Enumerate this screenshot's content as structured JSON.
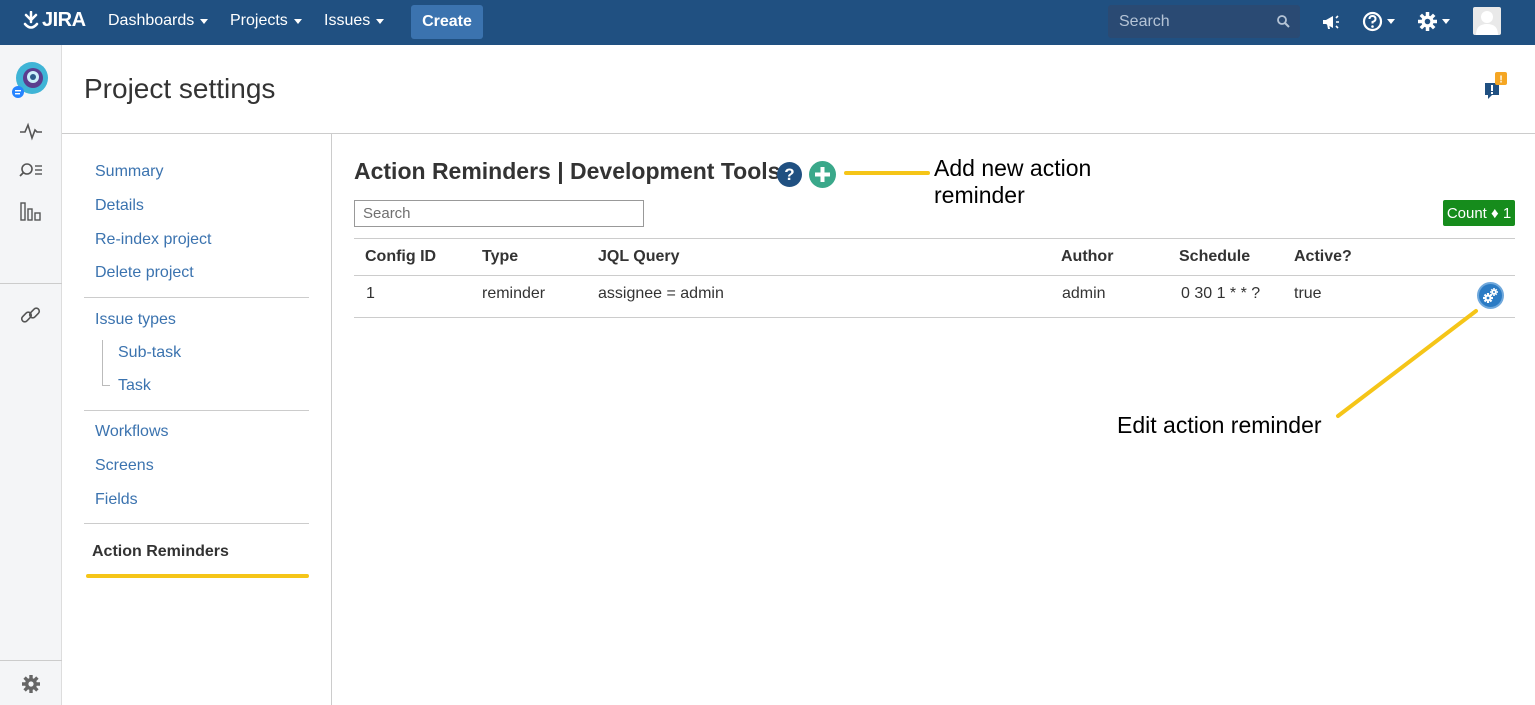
{
  "topbar": {
    "logo": "JIRA",
    "nav": [
      "Dashboards",
      "Projects",
      "Issues"
    ],
    "create_label": "Create",
    "search_placeholder": "Search"
  },
  "header": {
    "title": "Project settings",
    "feedback_badge": "!"
  },
  "settings_nav": {
    "group1": [
      "Summary",
      "Details",
      "Re-index project",
      "Delete project"
    ],
    "issue_types": "Issue types",
    "issue_type_children": [
      "Sub-task",
      "Task"
    ],
    "group3": [
      "Workflows",
      "Screens",
      "Fields"
    ],
    "active": "Action Reminders"
  },
  "main": {
    "title": "Action Reminders | Development Tools",
    "help_label": "?",
    "search_placeholder": "Search",
    "count_label": "Count ♦ 1",
    "annotation_add": "Add new action reminder",
    "annotation_edit": "Edit action reminder",
    "columns": [
      "Config ID",
      "Type",
      "JQL Query",
      "Author",
      "Schedule",
      "Active?"
    ],
    "rows": [
      {
        "config_id": "1",
        "type": "reminder",
        "jql": "assignee = admin",
        "author": "admin",
        "schedule": "0 30 1 * * ?",
        "active": "true"
      }
    ]
  },
  "colors": {
    "topbar": "#205081",
    "link": "#3b73af",
    "highlight": "#f5c518",
    "count_badge": "#168c1c"
  }
}
